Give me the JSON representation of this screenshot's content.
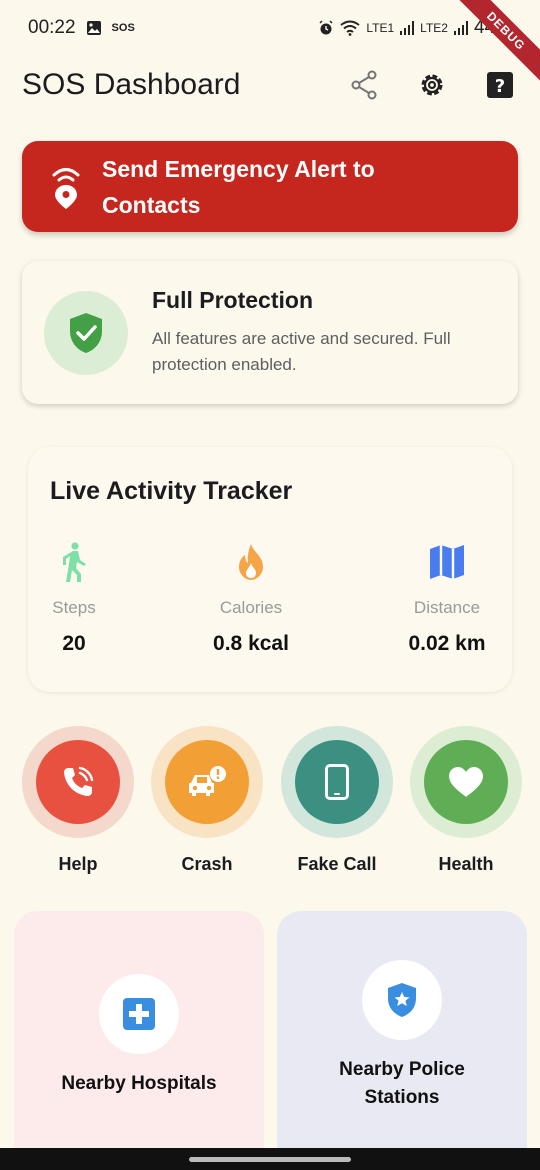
{
  "status_bar": {
    "time": "00:22",
    "sos_tag": "SOS",
    "sim1_label": "LTE1",
    "sim2_label": "LTE2",
    "battery": "44%"
  },
  "debug_ribbon": "DEBUG",
  "app_bar": {
    "title": "SOS Dashboard",
    "icons": [
      "share-icon",
      "gear-icon",
      "help-icon"
    ]
  },
  "alert_button": {
    "label": "Send Emergency Alert to Contacts",
    "color": "#c5261e"
  },
  "protection": {
    "title": "Full Protection",
    "description": "All features are active and secured. Full protection enabled.",
    "accent": "#43a047"
  },
  "tracker": {
    "title": "Live Activity Tracker",
    "metrics": [
      {
        "name": "Steps",
        "value": "20",
        "icon": "walking-icon",
        "color": "#7ee0a6"
      },
      {
        "name": "Calories",
        "value": "0.8 kcal",
        "icon": "flame-icon",
        "color": "#f5a447"
      },
      {
        "name": "Distance",
        "value": "0.02 km",
        "icon": "map-icon",
        "color": "#4a7cf0"
      }
    ]
  },
  "quick_actions": [
    {
      "label": "Help",
      "icon": "phone-ringing-icon",
      "color": "#e8503f",
      "ring": "#f4d8cc"
    },
    {
      "label": "Crash",
      "icon": "car-crash-icon",
      "color": "#f29f35",
      "ring": "#f8e4c4"
    },
    {
      "label": "Fake Call",
      "icon": "smartphone-icon",
      "color": "#3b9082",
      "ring": "#d3e6db"
    },
    {
      "label": "Health",
      "icon": "heart-icon",
      "color": "#5fae55",
      "ring": "#dcedd3"
    }
  ],
  "nearby": [
    {
      "label": "Nearby Hospitals",
      "icon": "hospital-cross-icon",
      "bg": "#fdeaea",
      "accent": "#3a8ee0"
    },
    {
      "label": "Nearby Police Stations",
      "icon": "police-badge-icon",
      "bg": "#e9e9f4",
      "accent": "#3a8ee0"
    }
  ]
}
